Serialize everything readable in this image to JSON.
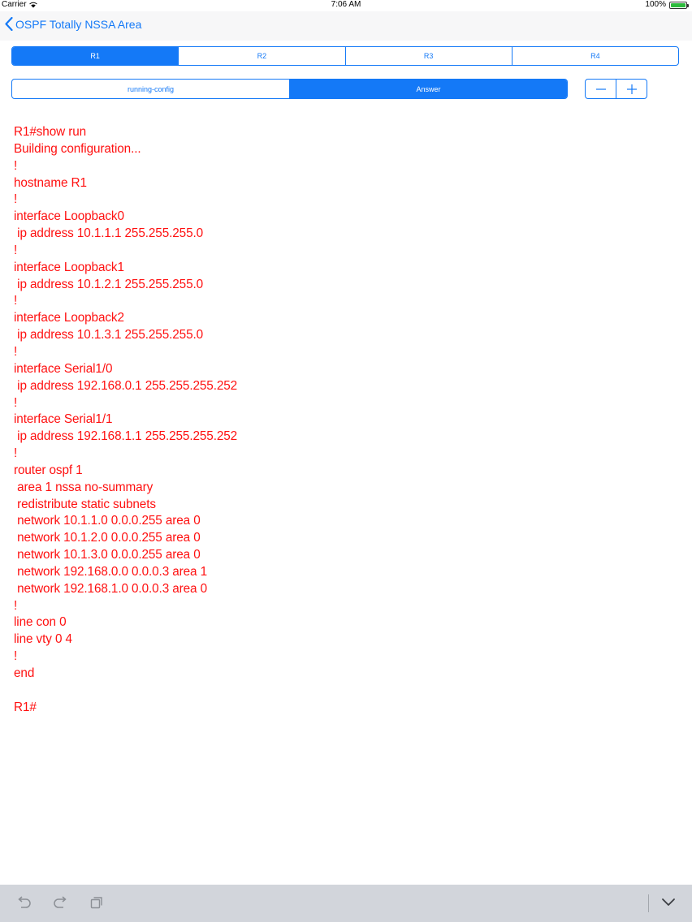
{
  "status_bar": {
    "carrier": "Carrier",
    "time": "7:06 AM",
    "battery": "100%",
    "battery_level": 1.0
  },
  "nav": {
    "back_label": "OSPF Totally NSSA Area"
  },
  "router_tabs": [
    {
      "label": "R1",
      "selected": true
    },
    {
      "label": "R2",
      "selected": false
    },
    {
      "label": "R3",
      "selected": false
    },
    {
      "label": "R4",
      "selected": false
    }
  ],
  "config_tabs": [
    {
      "label": "running-config",
      "selected": false
    },
    {
      "label": "Answer",
      "selected": true
    }
  ],
  "stepper": {
    "minus_icon": "minus-icon",
    "plus_icon": "plus-icon"
  },
  "config_text": "R1#show run\nBuilding configuration...\n!\nhostname R1\n!\ninterface Loopback0\n ip address 10.1.1.1 255.255.255.0\n!\ninterface Loopback1\n ip address 10.1.2.1 255.255.255.0\n!\ninterface Loopback2\n ip address 10.1.3.1 255.255.255.0\n!\ninterface Serial1/0\n ip address 192.168.0.1 255.255.255.252\n!\ninterface Serial1/1\n ip address 192.168.1.1 255.255.255.252\n!\nrouter ospf 1\n area 1 nssa no-summary\n redistribute static subnets\n network 10.1.1.0 0.0.0.255 area 0\n network 10.1.2.0 0.0.0.255 area 0\n network 10.1.3.0 0.0.0.255 area 0\n network 192.168.0.0 0.0.0.3 area 1\n network 192.168.1.0 0.0.0.3 area 0\n!\nline con 0\nline vty 0 4\n!\nend\n\nR1#",
  "colors": {
    "accent": "#1479f7",
    "config_text": "#ff1010",
    "toolbar_bg": "#d2d5db",
    "battery": "#2dbb3d"
  },
  "toolbar": {
    "undo_icon": "undo-icon",
    "redo_icon": "redo-icon",
    "paste_icon": "paste-icon",
    "dismiss_keyboard_icon": "chevron-down-icon"
  }
}
